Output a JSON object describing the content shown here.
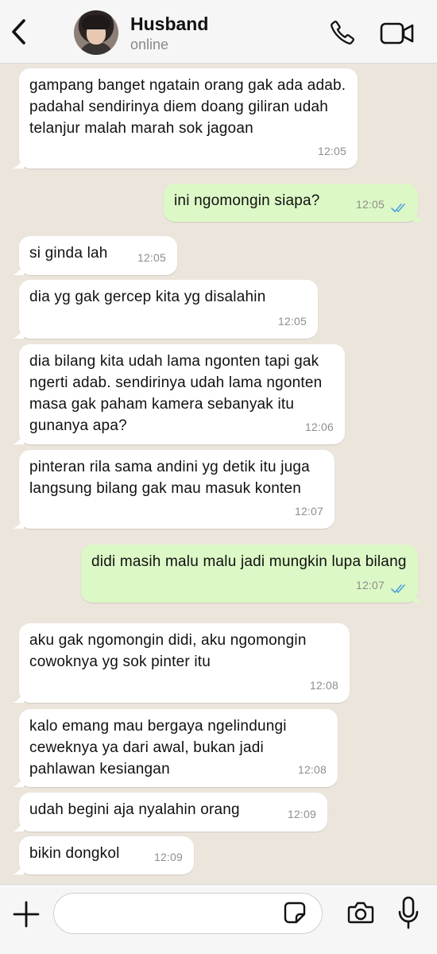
{
  "header": {
    "contact_name": "Husband",
    "status": "online",
    "back_icon": "chevron-left-icon",
    "call_icon": "phone-icon",
    "video_icon": "video-camera-icon"
  },
  "colors": {
    "incoming_bubble": "#ffffff",
    "outgoing_bubble": "#dcf8c6",
    "read_ticks": "#4fa3e0",
    "chat_background": "#ece5dc"
  },
  "messages": [
    {
      "direction": "in",
      "text": "gampang banget ngatain orang gak ada adab. padahal sendirinya diem doang giliran udah telanjur malah marah sok jagoan",
      "time": "12:05"
    },
    {
      "direction": "out",
      "text": "ini ngomongin siapa?",
      "time": "12:05",
      "read": true
    },
    {
      "direction": "in",
      "text": "si ginda lah",
      "time": "12:05"
    },
    {
      "direction": "in",
      "text": "dia yg gak gercep kita yg disalahin",
      "time": "12:05"
    },
    {
      "direction": "in",
      "text": "dia bilang kita udah lama ngonten tapi gak ngerti adab. sendirinya udah lama ngonten masa gak paham kamera sebanyak itu gunanya apa?",
      "time": "12:06"
    },
    {
      "direction": "in",
      "text": "pinteran rila sama andini yg detik itu juga langsung bilang gak mau masuk konten",
      "time": "12:07"
    },
    {
      "direction": "out",
      "text": "didi masih malu malu jadi mungkin lupa bilang",
      "time": "12:07",
      "read": true
    },
    {
      "direction": "in",
      "text": "aku gak ngomongin didi, aku ngomongin cowoknya yg sok pinter itu",
      "time": "12:08"
    },
    {
      "direction": "in",
      "text": "kalo emang mau bergaya ngelindungi ceweknya ya dari awal, bukan jadi pahlawan kesiangan",
      "time": "12:08"
    },
    {
      "direction": "in",
      "text": "udah begini aja nyalahin orang",
      "time": "12:09"
    },
    {
      "direction": "in",
      "text": "bikin dongkol",
      "time": "12:09"
    }
  ],
  "composer": {
    "input_value": "",
    "plus_icon": "plus-icon",
    "sticker_icon": "sticker-icon",
    "camera_icon": "camera-icon",
    "mic_icon": "microphone-icon"
  }
}
